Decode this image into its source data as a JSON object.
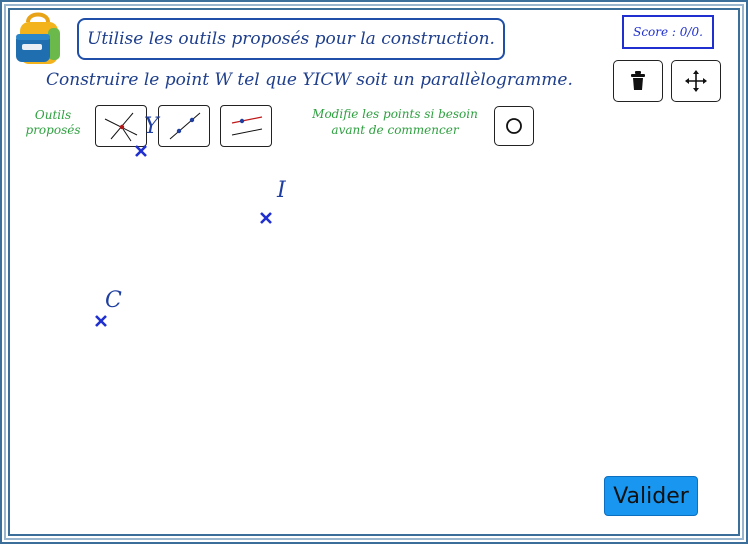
{
  "header": {
    "instruction": "Utilise les outils proposés pour la construction.",
    "score": "Score : 0/0."
  },
  "task": "Construire le point W tel que YICW soit un parallèlogramme.",
  "toolbar": {
    "delete_icon": "trash-icon",
    "move_icon": "move-arrows-icon"
  },
  "tools": {
    "label_line1": "Outils",
    "label_line2": "proposés",
    "items": [
      {
        "name": "intersection-tool",
        "icon": "intersecting-lines-icon"
      },
      {
        "name": "line-through-two-points-tool",
        "icon": "line-two-points-icon"
      },
      {
        "name": "parallel-line-tool",
        "icon": "parallel-lines-icon"
      }
    ]
  },
  "modify": {
    "line1": "Modifie les points si besoin",
    "line2": "avant de commencer",
    "icon": "circle-icon"
  },
  "points": [
    {
      "label": "Y"
    },
    {
      "label": "I"
    },
    {
      "label": "C"
    }
  ],
  "validate_label": "Valider",
  "colors": {
    "frame": "#3b6e98",
    "point": "#1f3fa0",
    "accent_green": "#2fa040",
    "validate_button": "#1896f0"
  }
}
